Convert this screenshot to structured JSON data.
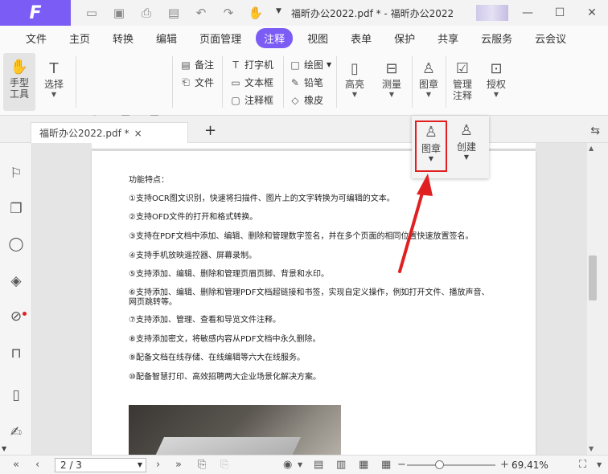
{
  "app": {
    "title": "福昕办公2022.pdf * - 福昕办公2022",
    "logo_letter": "F"
  },
  "menu": {
    "items": [
      "文件",
      "主页",
      "转换",
      "编辑",
      "页面管理",
      "注释",
      "视图",
      "表单",
      "保护",
      "共享",
      "云服务",
      "云会议"
    ],
    "active": "注释"
  },
  "ribbon": {
    "hand": "手型\n工具",
    "select": "选择",
    "note": "备注",
    "file": "文件",
    "typewriter": "打字机",
    "textbox": "文本框",
    "callout": "注释框",
    "draw": "绘图",
    "pencil": "铅笔",
    "eraser": "橡皮",
    "highlight": "高亮",
    "measure": "测量",
    "stamp": "图章",
    "manage": "管理\n注释",
    "authorize": "授权"
  },
  "popup": {
    "stamp": "图章",
    "create": "创建"
  },
  "tab": {
    "label": "福昕办公2022.pdf *",
    "close": "×",
    "new": "+"
  },
  "document": {
    "lines": [
      "功能特点：",
      "①支持OCR图文识别，快速将扫描件、图片上的文字转换为可编辑的文本。",
      "②支持OFD文件的打开和格式转换。",
      "③支持在PDF文档中添加、编辑、删除和管理数字签名，并在多个页面的相同位置快速放置签名。",
      "④支持手机放映遥控器、屏幕录制。",
      "⑤支持添加、编辑、删除和管理页眉页脚、背景和水印。",
      "⑥支持添加、编辑、删除和管理PDF文档超链接和书签，实现自定义操作，例如打开文件、播放声音、",
      "网页跳转等。",
      "⑦支持添加、管理、查看和导览文件注释。",
      "⑧支持添加密文，将敏感内容从PDF文档中永久删除。",
      "⑨配备文档在线存储、在线编辑等六大在线服务。",
      "⑩配备智慧打印、高效招聘两大企业场景化解决方案。"
    ]
  },
  "status": {
    "page": "2 / 3",
    "zoom": "69.41%",
    "zoom_level_fraction": 0.33
  },
  "colors": {
    "accent": "#7b5cf5",
    "highlight_red": "#e02020"
  }
}
